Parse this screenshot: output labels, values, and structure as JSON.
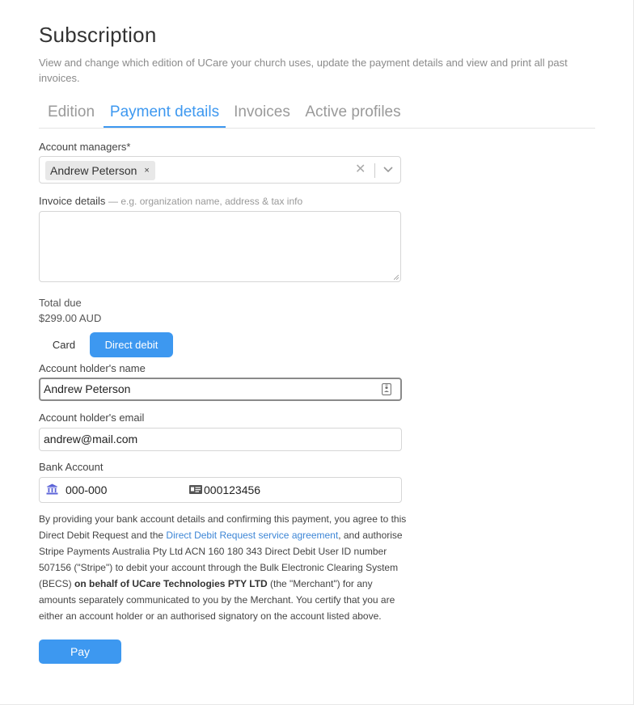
{
  "page": {
    "title": "Subscription",
    "subtitle": "View and change which edition of UCare your church uses, update the payment details and view and print all past invoices."
  },
  "tabs": [
    {
      "label": "Edition",
      "active": false
    },
    {
      "label": "Payment details",
      "active": true
    },
    {
      "label": "Invoices",
      "active": false
    },
    {
      "label": "Active profiles",
      "active": false
    }
  ],
  "account_managers": {
    "label": "Account managers*",
    "selected": [
      "Andrew Peterson"
    ],
    "remove_glyph": "×",
    "clear_glyph": "✕"
  },
  "invoice_details": {
    "label": "Invoice details",
    "hint": "— e.g. organization name, address & tax info",
    "value": ""
  },
  "total": {
    "label": "Total due",
    "amount": "$299.00 AUD"
  },
  "payment_method": {
    "options": [
      "Card",
      "Direct debit"
    ],
    "selected": "Direct debit"
  },
  "holder_name": {
    "label": "Account holder's name",
    "value": "Andrew Peterson"
  },
  "holder_email": {
    "label": "Account holder's email",
    "value": "andrew@mail.com"
  },
  "bank_account": {
    "label": "Bank Account",
    "bsb": "000-000",
    "account_number": "000123456"
  },
  "legal": {
    "part1": "By providing your bank account details and confirming this payment, you agree to this Direct Debit Request and the ",
    "link": "Direct Debit Request service agreement",
    "part2": ", and authorise Stripe Payments Australia Pty Ltd ACN 160 180 343 Direct Debit User ID number 507156 (\"Stripe\") to debit your account through the Bulk Electronic Clearing System (BECS) ",
    "bold": "on behalf of UCare Technologies PTY LTD",
    "part3": " (the \"Merchant\") for any amounts separately communicated to you by the Merchant. You certify that you are either an account holder or an authorised signatory on the account listed above."
  },
  "pay_button": {
    "label": "Pay"
  },
  "colors": {
    "accent": "#3d98f0",
    "link": "#3d86d6",
    "bank_icon": "#5b63d8"
  },
  "icons": [
    "chevron-down-icon",
    "contact-card-icon",
    "bank-icon",
    "id-card-icon",
    "resize-handle-icon"
  ]
}
